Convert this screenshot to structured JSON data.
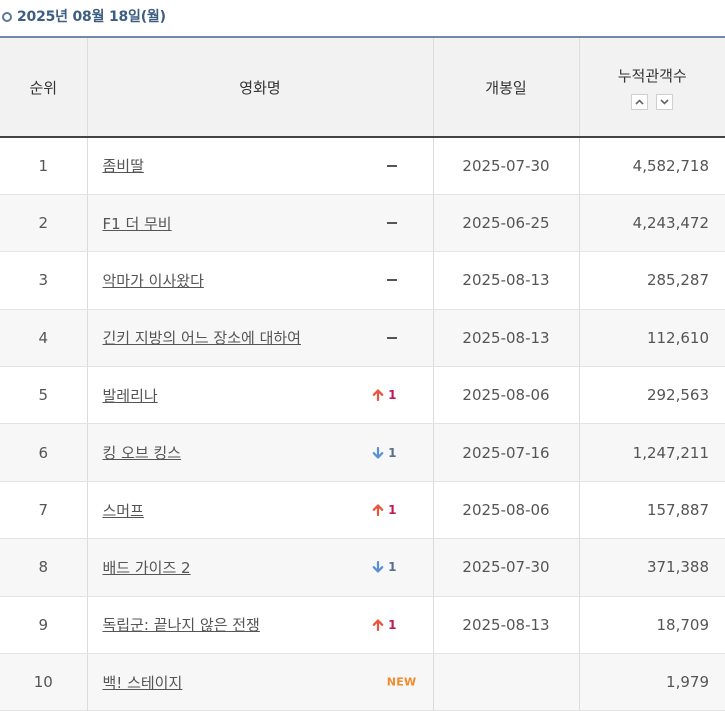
{
  "header": {
    "date": "2025년 08월 18일(월)"
  },
  "columns": {
    "rank": "순위",
    "title": "영화명",
    "release": "개봉일",
    "audience": "누적관객수"
  },
  "colors": {
    "up": "#e8553f",
    "down": "#5b8fd6",
    "new": "#f08b2c",
    "header_accent": "#3e5d82"
  },
  "rows": [
    {
      "rank": "1",
      "title": "좀비딸",
      "change_type": "same",
      "change": "",
      "release": "2025-07-30",
      "audience": "4,582,718"
    },
    {
      "rank": "2",
      "title": "F1 더 무비",
      "change_type": "same",
      "change": "",
      "release": "2025-06-25",
      "audience": "4,243,472"
    },
    {
      "rank": "3",
      "title": "악마가 이사왔다",
      "change_type": "same",
      "change": "",
      "release": "2025-08-13",
      "audience": "285,287"
    },
    {
      "rank": "4",
      "title": "긴키 지방의 어느 장소에 대하여",
      "change_type": "same",
      "change": "",
      "release": "2025-08-13",
      "audience": "112,610"
    },
    {
      "rank": "5",
      "title": "발레리나",
      "change_type": "up",
      "change": "1",
      "release": "2025-08-06",
      "audience": "292,563"
    },
    {
      "rank": "6",
      "title": "킹 오브 킹스",
      "change_type": "down",
      "change": "1",
      "release": "2025-07-16",
      "audience": "1,247,211"
    },
    {
      "rank": "7",
      "title": "스머프",
      "change_type": "up",
      "change": "1",
      "release": "2025-08-06",
      "audience": "157,887"
    },
    {
      "rank": "8",
      "title": "배드 가이즈 2",
      "change_type": "down",
      "change": "1",
      "release": "2025-07-30",
      "audience": "371,388"
    },
    {
      "rank": "9",
      "title": "독립군: 끝나지 않은 전쟁",
      "change_type": "up",
      "change": "1",
      "release": "2025-08-13",
      "audience": "18,709"
    },
    {
      "rank": "10",
      "title": "백! 스테이지",
      "change_type": "new",
      "change": "NEW",
      "release": "",
      "audience": "1,979"
    }
  ]
}
